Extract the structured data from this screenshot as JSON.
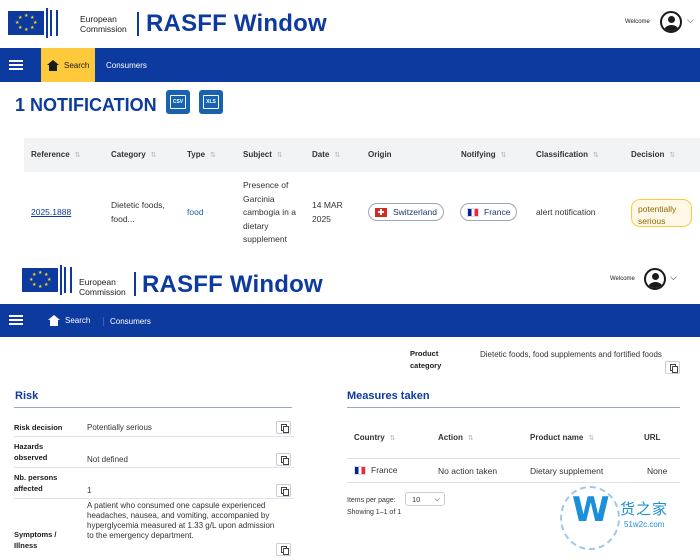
{
  "header": {
    "org_line1": "European",
    "org_line2": "Commission",
    "app_title": "RASFF Window",
    "welcome": "Welcome"
  },
  "nav": {
    "search": "Search",
    "consumers": "Consumers"
  },
  "results": {
    "title": "1 NOTIFICATION",
    "csv_label": "CSV",
    "xls_label": "XLS",
    "columns": [
      "Reference",
      "Category",
      "Type",
      "Subject",
      "Date",
      "Origin",
      "Notifying",
      "Classification",
      "Decision"
    ],
    "row": {
      "reference": "2025.1888",
      "category": "Dietetic foods, food...",
      "type": "food",
      "subject": "Presence of Garcinia cambogia in a dietary supplement",
      "date": "14 MAR 2025",
      "origin": "Switzerland",
      "notifying": "France",
      "classification": "alert notification",
      "decision": "potentially serious"
    }
  },
  "detail": {
    "product_category_label": "Product category",
    "product_category_value": "Dietetic foods, food supplements and fortified foods",
    "risk": {
      "title": "Risk",
      "rows": [
        {
          "label": "Risk decision",
          "value": "Potentially serious"
        },
        {
          "label": "Hazards observed",
          "value": "Not defined"
        },
        {
          "label": "Nb. persons affected",
          "value": "1"
        },
        {
          "label": "Symptoms / Illness",
          "value": "A patient who consumed one capsule experienced headaches, nausea, and vomiting, accompanied by hyperglycemia measured at 1.33 g/L upon admission to the emergency department."
        }
      ]
    },
    "measures": {
      "title": "Measures taken",
      "columns": [
        "Country",
        "Action",
        "Product name",
        "URL"
      ],
      "row": {
        "country": "France",
        "action": "No action taken",
        "product_name": "Dietary supplement",
        "url": "None"
      },
      "items_per_page_label": "Items per page:",
      "items_per_page_value": "10",
      "showing": "Showing 1–1 of 1"
    }
  },
  "watermark": {
    "brand": "货之家",
    "url": "51w2c.com"
  },
  "colors": {
    "brand_blue": "#0d3a9e",
    "accent_yellow": "#ffc93c",
    "link_blue": "#1863b0"
  }
}
